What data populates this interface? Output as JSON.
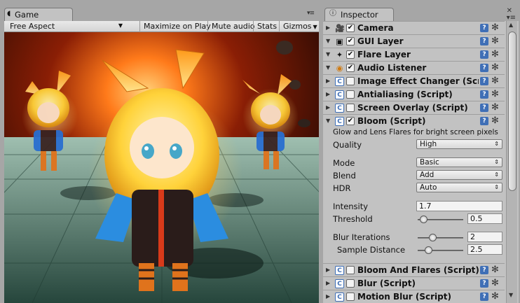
{
  "game": {
    "tab_label": "Game",
    "tab_icon": "pacman-game-icon",
    "aspect": "Free Aspect",
    "maximize_label": "Maximize on Play",
    "mute_label": "Mute audio",
    "stats_label": "Stats",
    "gizmos_label": "Gizmos"
  },
  "inspector": {
    "tab_label": "Inspector",
    "tab_icon": "inspector-info-icon",
    "components": [
      {
        "name": "Camera",
        "folded": true,
        "checked": true,
        "icon": "camera-icon"
      },
      {
        "name": "GUI Layer",
        "folded": true,
        "checked": true,
        "icon": "gui-layer-icon"
      },
      {
        "name": "Flare Layer",
        "folded": true,
        "checked": true,
        "icon": "flare-layer-icon"
      },
      {
        "name": "Audio Listener",
        "folded": true,
        "checked": true,
        "icon": "audio-listener-icon"
      },
      {
        "name": "Image Effect Changer (Scri",
        "folded": true,
        "checked": false,
        "icon": "script-icon"
      },
      {
        "name": "Antialiasing (Script)",
        "folded": true,
        "checked": false,
        "icon": "script-icon"
      },
      {
        "name": "Screen Overlay (Script)",
        "folded": true,
        "checked": false,
        "icon": "script-icon"
      },
      {
        "name": "Bloom (Script)",
        "folded": false,
        "checked": true,
        "icon": "script-icon"
      }
    ],
    "bloom": {
      "description": "Glow and Lens Flares for bright screen pixels",
      "quality_label": "Quality",
      "quality_value": "High",
      "mode_label": "Mode",
      "mode_value": "Basic",
      "blend_label": "Blend",
      "blend_value": "Add",
      "hdr_label": "HDR",
      "hdr_value": "Auto",
      "intensity_label": "Intensity",
      "intensity_value": "1.7",
      "threshold_label": "Threshold",
      "threshold_value": "0.5",
      "blur_iterations_label": "Blur Iterations",
      "blur_iterations_value": "2",
      "sample_distance_label": "Sample Distance",
      "sample_distance_value": "2.5"
    },
    "lower_components": [
      {
        "name": "Bloom And Flares (Script)",
        "checked": false,
        "icon": "script-icon"
      },
      {
        "name": "Blur (Script)",
        "checked": false,
        "icon": "script-icon"
      },
      {
        "name": "Motion Blur (Script)",
        "checked": false,
        "icon": "script-icon"
      }
    ]
  },
  "colors": {
    "panel_bg": "#a6a6a6",
    "inspector_bg": "#c2c2c2",
    "help_icon": "#3f6fb6",
    "flame_orange": "#ff8a1a"
  }
}
